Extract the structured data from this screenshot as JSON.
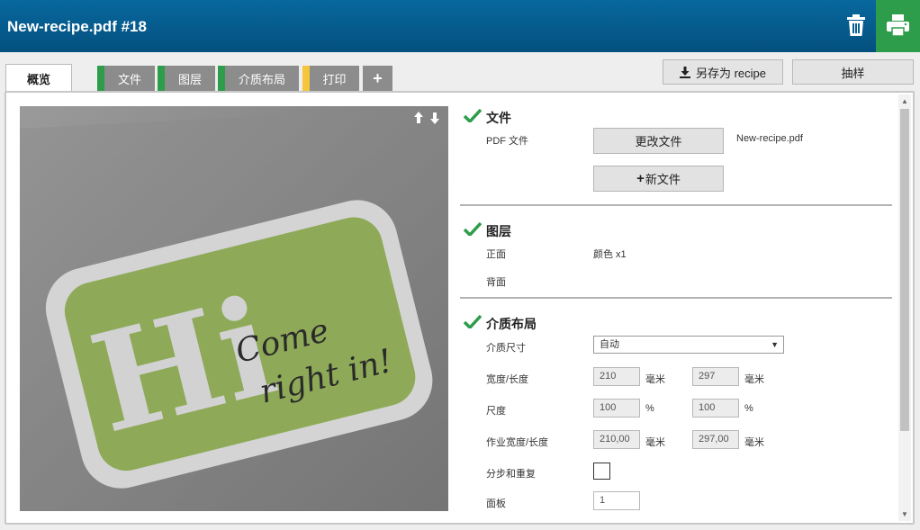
{
  "header": {
    "title": "New-recipe.pdf #18",
    "accent": "#04507e",
    "print_color": "#2e9d4b"
  },
  "tabs": [
    {
      "label": "概览",
      "bar": ""
    },
    {
      "label": "文件",
      "bar": "#2e9d4b"
    },
    {
      "label": "图层",
      "bar": "#2e9d4b"
    },
    {
      "label": "介质布局",
      "bar": "#2e9d4b"
    },
    {
      "label": "打印",
      "bar": "#f3c63c"
    },
    {
      "label": "+",
      "bar": ""
    }
  ],
  "toolbar": {
    "save_label": "另存为 recipe",
    "sample_label": "抽样"
  },
  "preview": {
    "arrows": "🡡🡣",
    "hi": "Hi",
    "line1": "Come",
    "line2": "right in!"
  },
  "sections": {
    "file": {
      "title": "文件",
      "pdf_label": "PDF 文件",
      "change_button": "更改文件",
      "new_button": "新文件",
      "filename": "New-recipe.pdf"
    },
    "layers": {
      "title": "图层",
      "front_label": "正面",
      "front_value": "颜色 x1",
      "back_label": "背面"
    },
    "media": {
      "title": "介质布局",
      "size_label": "介质尺寸",
      "size_value": "自动",
      "wh_label": "宽度/长度",
      "width": "210",
      "width_unit": "毫米",
      "height": "297",
      "height_unit": "毫米",
      "scale_label": "尺度",
      "scale_x": "100",
      "scale_x_unit": "%",
      "scale_y": "100",
      "scale_y_unit": "%",
      "job_label": "作业宽度/长度",
      "job_w": "210,00",
      "job_w_unit": "毫米",
      "job_h": "297,00",
      "job_h_unit": "毫米",
      "step_label": "分步和重复",
      "panel_label": "面板",
      "panel_value": "1"
    }
  }
}
